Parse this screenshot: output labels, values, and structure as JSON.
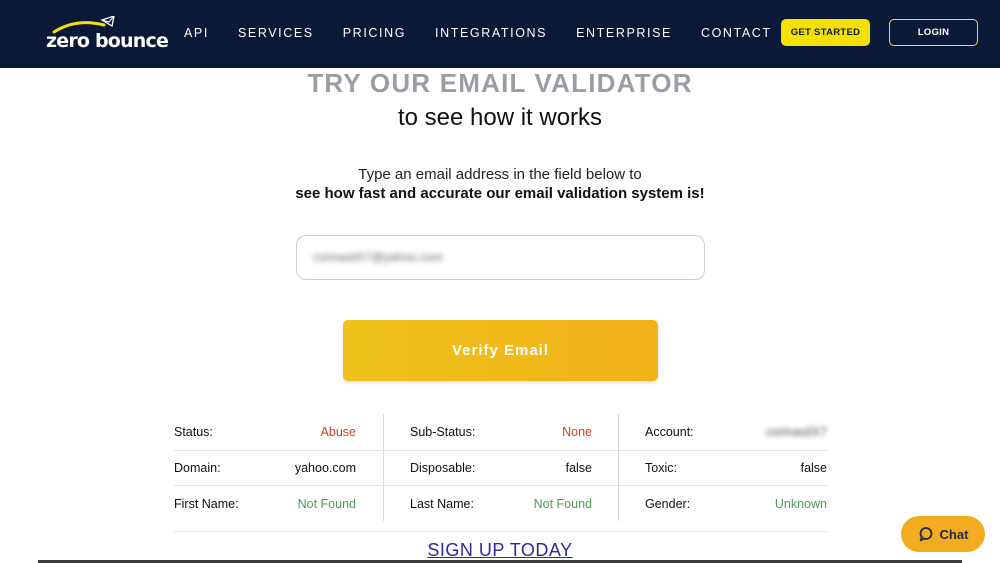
{
  "header": {
    "logo_text": "zero bounce",
    "nav": [
      "API",
      "SERVICES",
      "PRICING",
      "INTEGRATIONS",
      "ENTERPRISE",
      "CONTACT"
    ],
    "get_started_label": "GET STARTED",
    "login_label": "LOGIN"
  },
  "hero": {
    "title": "TRY OUR EMAIL VALIDATOR",
    "subtitle": "to see how it works",
    "desc_line1": "Type an email address in the field below to",
    "desc_line2": "see how fast and accurate our email validation system is!"
  },
  "email_input": {
    "value": "corinasilX7@yahoo.com"
  },
  "verify_button_label": "Verify Email",
  "results": {
    "rows": [
      [
        {
          "label": "Status:",
          "value": "Abuse",
          "tone": "red"
        },
        {
          "label": "Sub-Status:",
          "value": "None",
          "tone": "red"
        },
        {
          "label": "Account:",
          "value": "corinasilX7",
          "tone": "blurred"
        }
      ],
      [
        {
          "label": "Domain:",
          "value": "yahoo.com",
          "tone": "dark"
        },
        {
          "label": "Disposable:",
          "value": "false",
          "tone": "dark"
        },
        {
          "label": "Toxic:",
          "value": "false",
          "tone": "dark"
        }
      ],
      [
        {
          "label": "First Name:",
          "value": "Not Found",
          "tone": "green"
        },
        {
          "label": "Last Name:",
          "value": "Not Found",
          "tone": "green"
        },
        {
          "label": "Gender:",
          "value": "Unknown",
          "tone": "green"
        }
      ]
    ]
  },
  "signup_label": "SIGN UP TODAY",
  "chat_label": "Chat",
  "colors": {
    "header_bg": "#0b1838",
    "accent_yellow": "#f5e100",
    "verify_orange": "#efc21b",
    "chat_orange": "#f3ac1f",
    "status_red": "#c0442a",
    "status_green": "#4c9a5a"
  }
}
